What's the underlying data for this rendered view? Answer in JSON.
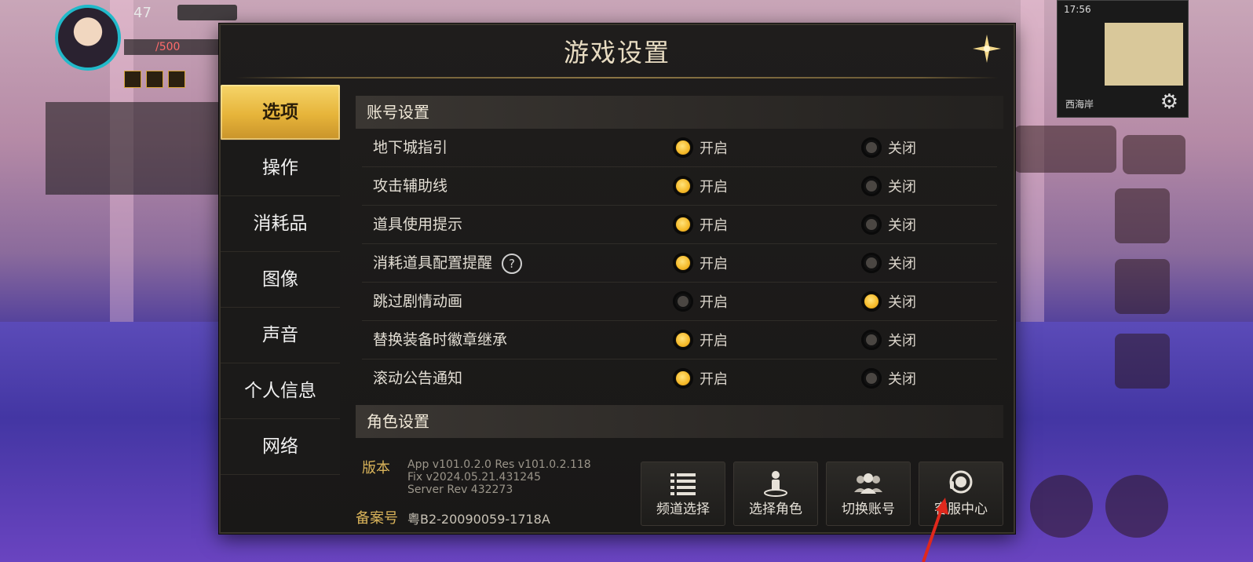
{
  "dialog": {
    "title": "游戏设置"
  },
  "tabs": [
    {
      "label": "选项",
      "active": true
    },
    {
      "label": "操作",
      "active": false
    },
    {
      "label": "消耗品",
      "active": false
    },
    {
      "label": "图像",
      "active": false
    },
    {
      "label": "声音",
      "active": false
    },
    {
      "label": "个人信息",
      "active": false
    },
    {
      "label": "网络",
      "active": false
    }
  ],
  "account_section": {
    "title": "账号设置",
    "on_label": "开启",
    "off_label": "关闭",
    "rows": [
      {
        "label": "地下城指引",
        "value": "on"
      },
      {
        "label": "攻击辅助线",
        "value": "on"
      },
      {
        "label": "道具使用提示",
        "value": "on"
      },
      {
        "label": "消耗道具配置提醒",
        "value": "on",
        "help": "?"
      },
      {
        "label": "跳过剧情动画",
        "value": "off"
      },
      {
        "label": "替换装备时徽章继承",
        "value": "on"
      },
      {
        "label": "滚动公告通知",
        "value": "on"
      }
    ]
  },
  "role_section": {
    "title": "角色设置"
  },
  "footer": {
    "version_label": "版本",
    "version_lines": [
      "App v101.0.2.0 Res v101.0.2.118",
      "Fix v2024.05.21.431245",
      "Server Rev 432273"
    ],
    "record_label": "备案号",
    "record_value": "粤B2-20090059-1718A"
  },
  "buttons": [
    {
      "label": "频道选择",
      "icon": "list-icon"
    },
    {
      "label": "选择角色",
      "icon": "character-select-icon"
    },
    {
      "label": "切换账号",
      "icon": "switch-account-icon"
    },
    {
      "label": "客服中心",
      "icon": "headset-icon"
    }
  ],
  "hud": {
    "level": "47",
    "hp": "/500",
    "map_name": "西海岸",
    "clock": "17:56"
  },
  "colors": {
    "accent_gold": "#f5b928",
    "tab_active": "#e6b43a",
    "panel_bg": "#1f1d1c"
  }
}
